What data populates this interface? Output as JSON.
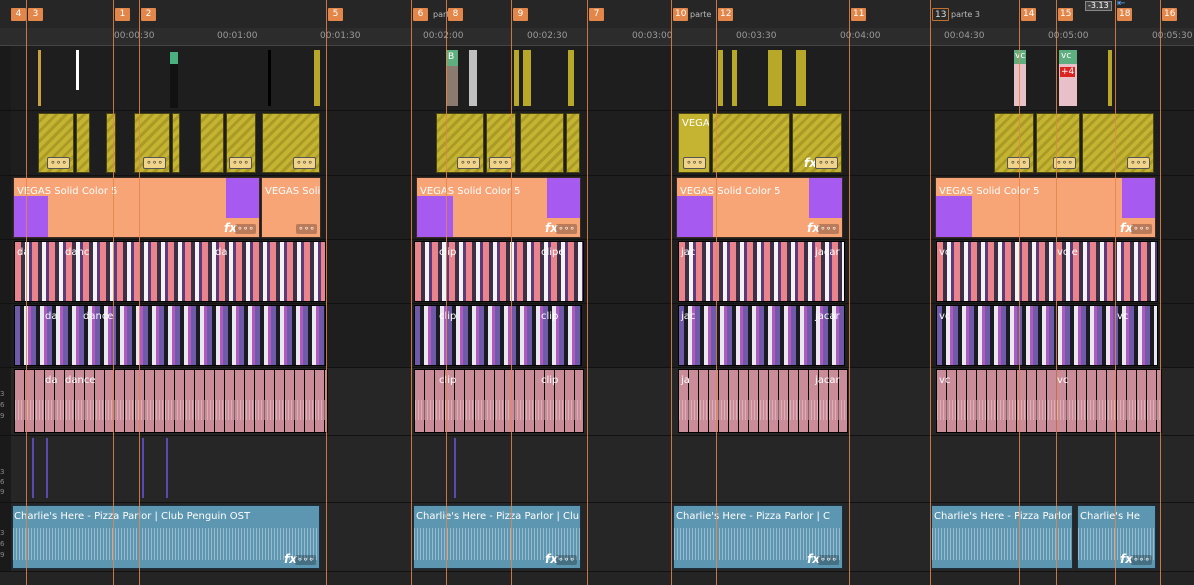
{
  "ruler": {
    "labels": [
      "00:00:30",
      "00:01:00",
      "00:01:30",
      "00:02:00",
      "00:02:30",
      "00:03:00",
      "00:03:30",
      "00:04:00",
      "00:04:30",
      "00:05:00",
      "00:05:30"
    ]
  },
  "markers": [
    "4",
    "3",
    "1",
    "2",
    "5",
    "6",
    "8",
    "9",
    "7",
    "10",
    "12",
    "11",
    "13",
    "14",
    "15",
    "18",
    "16"
  ],
  "regions": {
    "r1": "parte",
    "r2": "parte",
    "r3": "parte 3"
  },
  "cursor": {
    "time": "-3.13"
  },
  "tracks": {
    "gutter_labels": {
      "a1": [
        "3",
        "6",
        "9"
      ],
      "a2": [
        "3",
        "6",
        "9"
      ],
      "a3": [
        "3",
        "6",
        "9"
      ]
    },
    "solid_name": "VEGAS Solid Color 5",
    "solid_name_short": "VEGAS Solid",
    "vegas_title": "VEGAS",
    "video_clip_names": [
      "da",
      "da",
      "danc",
      "da",
      "d",
      "da",
      "d",
      "da",
      "dance",
      "clip",
      "clip",
      "clip",
      "clipe",
      "clip",
      "jac",
      "jac",
      "ja",
      "jac",
      "jacar",
      "vc",
      "vc",
      "vc",
      "vc",
      "vc e",
      "vc",
      "vc"
    ],
    "music_names": [
      "Charlie's Here - Pizza Parlor  |  Club Penguin OST",
      "Charlie's Here - Pizza Parlor  |  Clu",
      "Charlie's Here - Pizza Parlor  |  C",
      "Charlie's Here - Pizza Parlor  |  T",
      "Charlie's He"
    ],
    "fx": "fx",
    "dots": "∘∘∘",
    "small_tag_vc": "vc",
    "small_tag_b": "B",
    "small_tag_plus": "+4"
  },
  "colors": {
    "marker": "#e2864a",
    "solid": "#f7a477",
    "purple": "#a65af0",
    "hatch": "#c4b431",
    "music": "#5d96b0",
    "pink_audio": "#c98c98"
  }
}
